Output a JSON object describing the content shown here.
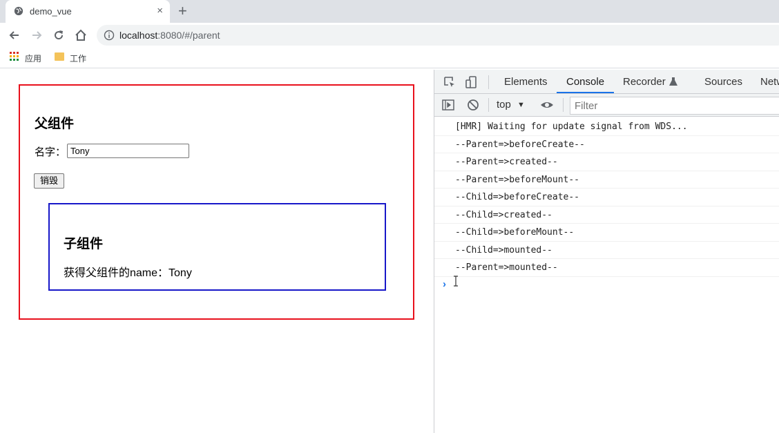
{
  "browser": {
    "tab_title": "demo_vue",
    "tab_close": "×",
    "new_tab": "+",
    "url_host": "localhost",
    "url_path": ":8080/#/parent",
    "bookmarks": [
      "应用",
      "工作"
    ]
  },
  "page": {
    "parent_title": "父组件",
    "name_label": "名字：",
    "name_value": "Tony",
    "destroy_label": "销毁",
    "child_title": "子组件",
    "child_text": "获得父组件的name：Tony"
  },
  "devtools": {
    "tabs": [
      "Elements",
      "Console",
      "Recorder",
      "Sources",
      "Netw"
    ],
    "active_tab": "Console",
    "context": "top",
    "filter_placeholder": "Filter",
    "logs": [
      "[HMR] Waiting for update signal from WDS...",
      "--Parent=>beforeCreate--",
      "--Parent=>created--",
      "--Parent=>beforeMount--",
      "--Child=>beforeCreate--",
      "--Child=>created--",
      "--Child=>beforeMount--",
      "--Child=>mounted--",
      "--Parent=>mounted--"
    ],
    "prompt": "›"
  },
  "colors": {
    "parent_border": "#e8101c",
    "child_border": "#1717c9",
    "accent": "#1a73e8"
  }
}
